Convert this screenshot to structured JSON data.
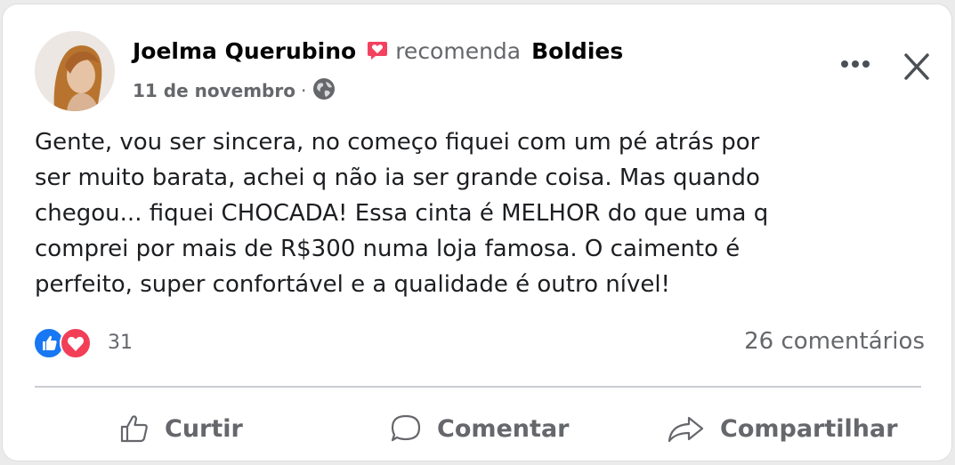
{
  "post": {
    "author": "Joelma Querubino",
    "recommends_text": "recomenda",
    "page_name": "Boldies",
    "date": "11 de novembro",
    "separator": "·",
    "body_lines": [
      "Gente, vou ser sincera, no começo fiquei com um pé atrás por",
      "ser muito barata, achei q não ia ser grande coisa. Mas quando",
      "chegou... fiquei CHOCADA! Essa cinta é MELHOR do que uma q",
      "comprei por mais de R$300 numa loja famosa. O caimento é",
      "perfeito, super confortável e a qualidade é outro nível!"
    ],
    "reaction_count": "31",
    "comments_count": "26 comentários"
  },
  "actions": {
    "like": "Curtir",
    "comment": "Comentar",
    "share": "Compartilhar"
  },
  "icons": {
    "recommend": "recommend-icon",
    "audience": "globe-icon",
    "more": "more-options-icon",
    "close": "close-icon",
    "like_reaction": "like-reaction-icon",
    "love_reaction": "love-reaction-icon"
  },
  "colors": {
    "like_blue": "#1877f2",
    "love_red": "#f33e58",
    "recommend_pink": "#f3425f",
    "secondary_text": "#65676b"
  }
}
